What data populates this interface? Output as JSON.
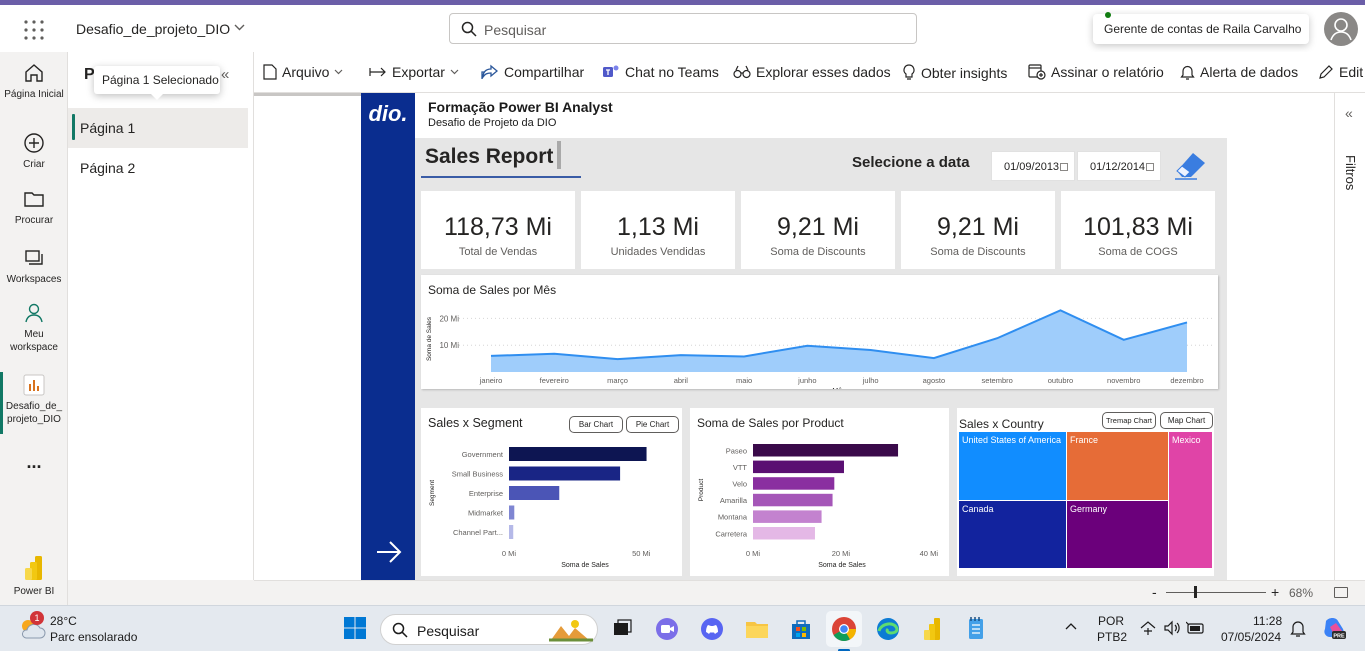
{
  "topbar": {
    "workspace_name": "Desafio_de_projeto_DIO",
    "search_placeholder": "Pesquisar",
    "account_tooltip": "Gerente de contas de Raila Carvalho"
  },
  "leftrail": {
    "items": [
      {
        "label": "Página Inicial",
        "icon": "home-icon"
      },
      {
        "label": "Criar",
        "icon": "plus-circle-icon"
      },
      {
        "label": "Procurar",
        "icon": "folder-icon"
      },
      {
        "label": "Workspaces",
        "icon": "workspaces-icon"
      },
      {
        "label": "Meu workspace",
        "icon": "person-icon"
      },
      {
        "label": "Desafio_de_ projeto_DIO",
        "icon": "report-icon"
      },
      {
        "label": "...",
        "icon": "more-icon"
      },
      {
        "label": "Power BI",
        "icon": "powerbi-icon"
      }
    ]
  },
  "pages": {
    "title": "P",
    "tooltip": "Página 1 Selecionado",
    "items": [
      "Página 1",
      "Página 2"
    ]
  },
  "toolbar": {
    "items": [
      {
        "label": "Arquivo",
        "icon": "file-icon"
      },
      {
        "label": "Exportar",
        "icon": "export-icon"
      },
      {
        "label": "Compartilhar",
        "icon": "share-icon"
      },
      {
        "label": "Chat no Teams",
        "icon": "teams-icon"
      },
      {
        "label": "Explorar esses dados",
        "icon": "binoculars-icon"
      },
      {
        "label": "Obter insights",
        "icon": "lightbulb-icon"
      },
      {
        "label": "Assinar o relatório",
        "icon": "subscribe-icon"
      },
      {
        "label": "Alerta de dados",
        "icon": "bell-icon"
      },
      {
        "label": "Edit",
        "icon": "pencil-icon"
      }
    ]
  },
  "report": {
    "logo_text": "dio.",
    "title": "Formação Power BI Analyst",
    "subtitle": "Desafio de Projeto da DIO",
    "page_title": "Sales Report",
    "date_label": "Selecione a data",
    "date_start": "01/09/2013",
    "date_end": "01/12/2014",
    "kpis": [
      {
        "value": "118,73 Mi",
        "label": "Total de Vendas"
      },
      {
        "value": "1,13 Mi",
        "label": "Unidades Vendidas"
      },
      {
        "value": "9,21 Mi",
        "label": "Soma de Discounts"
      },
      {
        "value": "9,21 Mi",
        "label": "Soma de Discounts"
      },
      {
        "value": "101,83 Mi",
        "label": "Soma de COGS"
      }
    ],
    "segment_panel": {
      "title": "Sales x Segment",
      "btn1": "Bar Chart",
      "btn2": "Pie Chart"
    },
    "product_panel": {
      "title": "Soma de Sales por Product"
    },
    "country_panel": {
      "title": "Sales x Country",
      "btn1": "Tremap Chart",
      "btn2": "Map Chart"
    }
  },
  "chart_data": [
    {
      "type": "area",
      "title": "Soma de Sales por Mês",
      "xlabel": "Mês",
      "ylabel": "Soma de Sales",
      "categories": [
        "janeiro",
        "fevereiro",
        "março",
        "abril",
        "maio",
        "junho",
        "julho",
        "agosto",
        "setembro",
        "outubro",
        "novembro",
        "dezembro"
      ],
      "values": [
        6.0,
        6.8,
        4.8,
        6.3,
        5.8,
        9.8,
        8.2,
        5.2,
        12.6,
        23.0,
        12.0,
        18.5
      ],
      "yticks": [
        "10 Mi",
        "20 Mi"
      ],
      "ytick_values": [
        10,
        20
      ],
      "ylim": [
        0,
        25
      ],
      "color": "#2f8ef0"
    },
    {
      "type": "bar",
      "orientation": "horizontal",
      "title": "Sales x Segment",
      "xlabel": "Soma de Sales",
      "ylabel": "Segment",
      "categories": [
        "Government",
        "Small Business",
        "Enterprise",
        "Midmarket",
        "Channel Part..."
      ],
      "values": [
        52,
        42,
        19,
        2,
        1.6
      ],
      "colors": [
        "#0d1552",
        "#192585",
        "#4b55b6",
        "#7f86d2",
        "#b5b9e8"
      ],
      "xticks": [
        "0 Mi",
        "50 Mi"
      ],
      "xtick_values": [
        0,
        50
      ],
      "xlim": [
        0,
        62
      ]
    },
    {
      "type": "bar",
      "orientation": "horizontal",
      "title": "Soma de Sales por Product",
      "xlabel": "Soma de Sales",
      "ylabel": "Product",
      "categories": [
        "Paseo",
        "VTT",
        "Velo",
        "Amarilla",
        "Montana",
        "Carretera"
      ],
      "values": [
        33,
        20.7,
        18.5,
        18.1,
        15.6,
        14.1
      ],
      "colors": [
        "#3a0a4a",
        "#5a0f72",
        "#8a2fa0",
        "#a556b8",
        "#c382cf",
        "#e4b8e6"
      ],
      "xticks": [
        "0 Mi",
        "20 Mi",
        "40 Mi"
      ],
      "xtick_values": [
        0,
        20,
        40
      ],
      "xlim": [
        0,
        43
      ]
    },
    {
      "type": "treemap",
      "title": "Sales x Country",
      "categories": [
        "United States of America",
        "France",
        "Mexico",
        "Canada",
        "Germany"
      ],
      "colors": [
        "#118dff",
        "#e66c37",
        "#e044a7",
        "#12239e",
        "#6b007b"
      ]
    }
  ],
  "statusbar": {
    "zoom": "68%"
  },
  "taskbar": {
    "weather_temp": "28°C",
    "weather_desc": "Parc ensolarado",
    "weather_badge": "1",
    "search_placeholder": "Pesquisar",
    "lang": "POR",
    "layout": "PTB2",
    "time": "11:28",
    "date": "07/05/2024"
  }
}
